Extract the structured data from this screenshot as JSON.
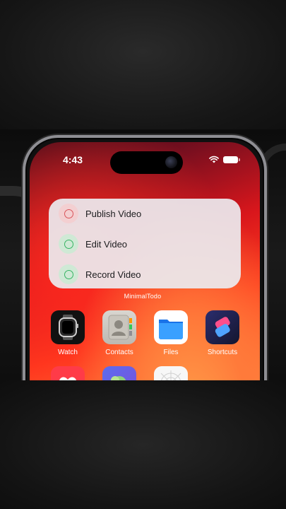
{
  "status": {
    "time": "4:43"
  },
  "widget": {
    "items": [
      {
        "label": "Publish Video",
        "ring_color": "#d9545a",
        "bg_color": "#f3cfd1"
      },
      {
        "label": "Edit Video",
        "ring_color": "#37b463",
        "bg_color": "#cfe9d5"
      },
      {
        "label": "Record Video",
        "ring_color": "#37b463",
        "bg_color": "#cfe9d5"
      }
    ],
    "app_name": "MinimalTodo"
  },
  "apps_row1": [
    {
      "label": "Watch",
      "icon": "watch-icon"
    },
    {
      "label": "Contacts",
      "icon": "contacts-icon"
    },
    {
      "label": "Files",
      "icon": "files-icon"
    },
    {
      "label": "Shortcuts",
      "icon": "shortcuts-icon"
    }
  ],
  "apps_row2": [
    {
      "icon": "health-icon"
    },
    {
      "icon": "gallery-icon"
    },
    {
      "icon": "freeform-icon"
    }
  ]
}
